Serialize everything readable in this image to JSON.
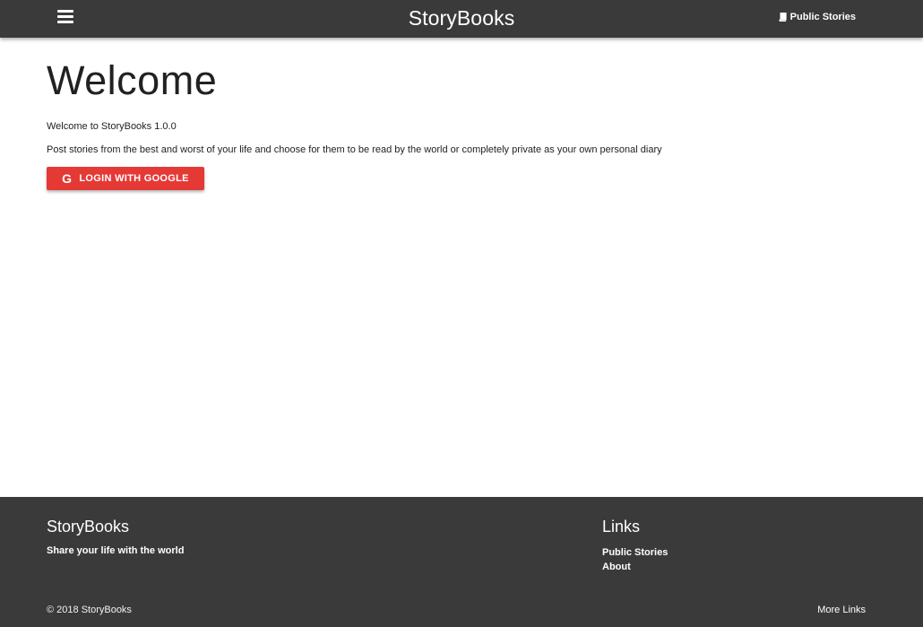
{
  "navbar": {
    "menu_icon": "hamburger-menu-icon",
    "brand": "StoryBooks",
    "public_stories_icon": "book-icon",
    "public_stories_label": "Public Stories"
  },
  "main": {
    "title": "Welcome",
    "welcome_text": "Welcome to StoryBooks 1.0.0",
    "description": "Post stories from the best and worst of your life and choose for them to be read by the world or completely private as your own personal diary",
    "login_button": {
      "icon": "google-icon",
      "icon_glyph": "G",
      "label": "LOGIN WITH GOOGLE"
    }
  },
  "footer": {
    "brand": "StoryBooks",
    "tagline": "Share your life with the world",
    "links_title": "Links",
    "links": [
      "Public Stories",
      "About"
    ],
    "copyright": "© 2018 StoryBooks",
    "more_links": "More Links"
  },
  "colors": {
    "navbar_bg": "#3a3a3a",
    "footer_bg": "#3a3a3a",
    "login_button_bg": "#e53935"
  }
}
